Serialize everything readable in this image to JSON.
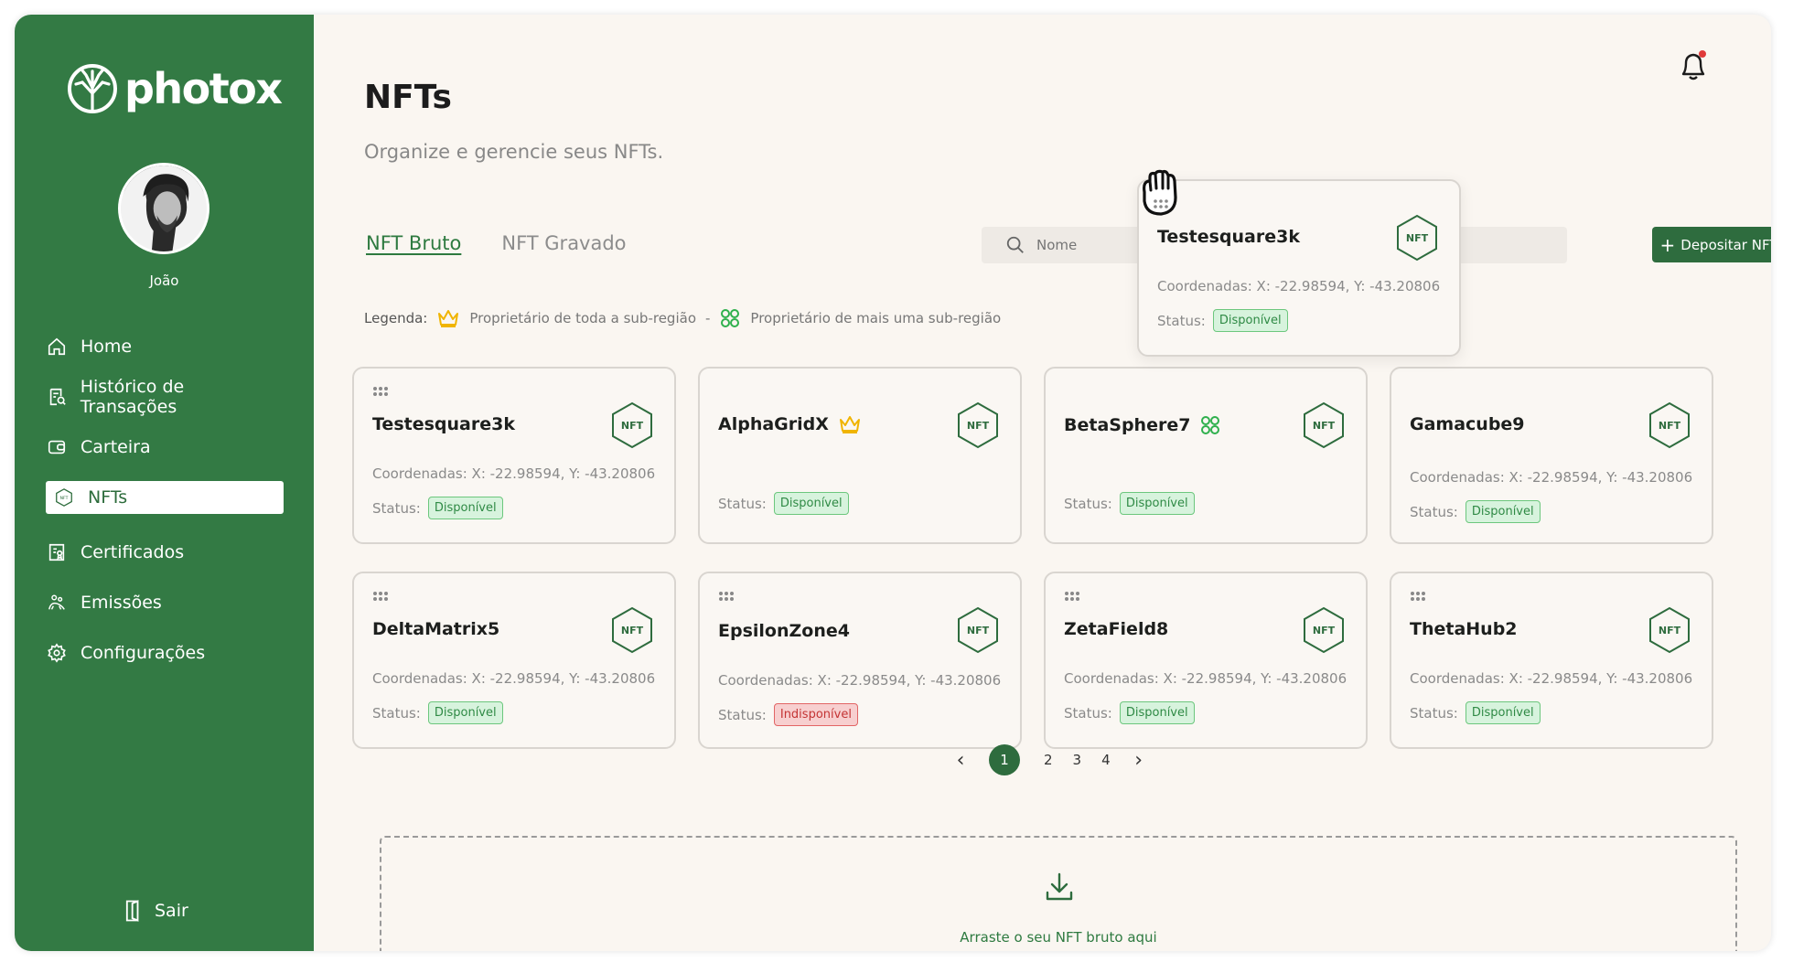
{
  "brand": {
    "name": "photox"
  },
  "user": {
    "name": "João"
  },
  "sidebar": {
    "items": [
      {
        "label": "Home",
        "icon": "home-icon"
      },
      {
        "label": "Histórico de Transações",
        "icon": "receipt-search-icon"
      },
      {
        "label": "Carteira",
        "icon": "wallet-icon"
      },
      {
        "label": "NFTs",
        "icon": "nft-icon",
        "active": true
      },
      {
        "label": "Certificados",
        "icon": "certificate-icon"
      },
      {
        "label": "Emissões",
        "icon": "emissions-icon"
      },
      {
        "label": "Configurações",
        "icon": "gear-icon"
      }
    ],
    "logout": "Sair"
  },
  "header": {
    "title": "NFTs",
    "subtitle": "Organize e gerencie seus NFTs."
  },
  "tabs": [
    {
      "label": "NFT Bruto",
      "active": true
    },
    {
      "label": "NFT Gravado",
      "active": false
    }
  ],
  "search": {
    "placeholder": "Nome"
  },
  "deposit_button": {
    "label": "Depositar NFT"
  },
  "legend": {
    "label": "Legenda:",
    "crown": "Proprietário de toda a sub-região",
    "separator": "-",
    "multi": "Proprietário de mais uma sub-região"
  },
  "card_labels": {
    "coords": "Coordenadas:",
    "status": "Status:",
    "hex": "NFT"
  },
  "cards": [
    {
      "name": "Testesquare3k",
      "coords": "X: -22.98594, Y: -43.20806",
      "status": "Disponível",
      "badge": "",
      "grip": true
    },
    {
      "name": "AlphaGridX",
      "coords": "",
      "status": "Disponível",
      "badge": "crown",
      "grip": false
    },
    {
      "name": "BetaSphere7",
      "coords": "",
      "status": "Disponível",
      "badge": "multi",
      "grip": false
    },
    {
      "name": "Gamacube9",
      "coords": "X: -22.98594, Y: -43.20806",
      "status": "Disponível",
      "badge": "",
      "grip": false
    },
    {
      "name": "DeltaMatrix5",
      "coords": "X: -22.98594, Y: -43.20806",
      "status": "Disponível",
      "badge": "",
      "grip": true
    },
    {
      "name": "EpsilonZone4",
      "coords": "X: -22.98594, Y: -43.20806",
      "status": "Indisponível",
      "badge": "",
      "grip": true
    },
    {
      "name": "ZetaField8",
      "coords": "X: -22.98594, Y: -43.20806",
      "status": "Disponível",
      "badge": "",
      "grip": true
    },
    {
      "name": "ThetaHub2",
      "coords": "X: -22.98594, Y: -43.20806",
      "status": "Disponível",
      "badge": "",
      "grip": true
    }
  ],
  "dragging_card": {
    "name": "Testesquare3k",
    "coords": "X: -22.98594, Y: -43.20806",
    "status": "Disponível"
  },
  "pagination": {
    "pages": [
      "1",
      "2",
      "3",
      "4"
    ],
    "current": "1"
  },
  "dropzone": {
    "text": "Arraste o seu NFT bruto aqui"
  },
  "colors": {
    "sidebar": "#337a44",
    "accent": "#2e6c3e",
    "available": "#d7f3dd",
    "unavailable": "#f7cfcf",
    "crown": "#f0b400"
  }
}
